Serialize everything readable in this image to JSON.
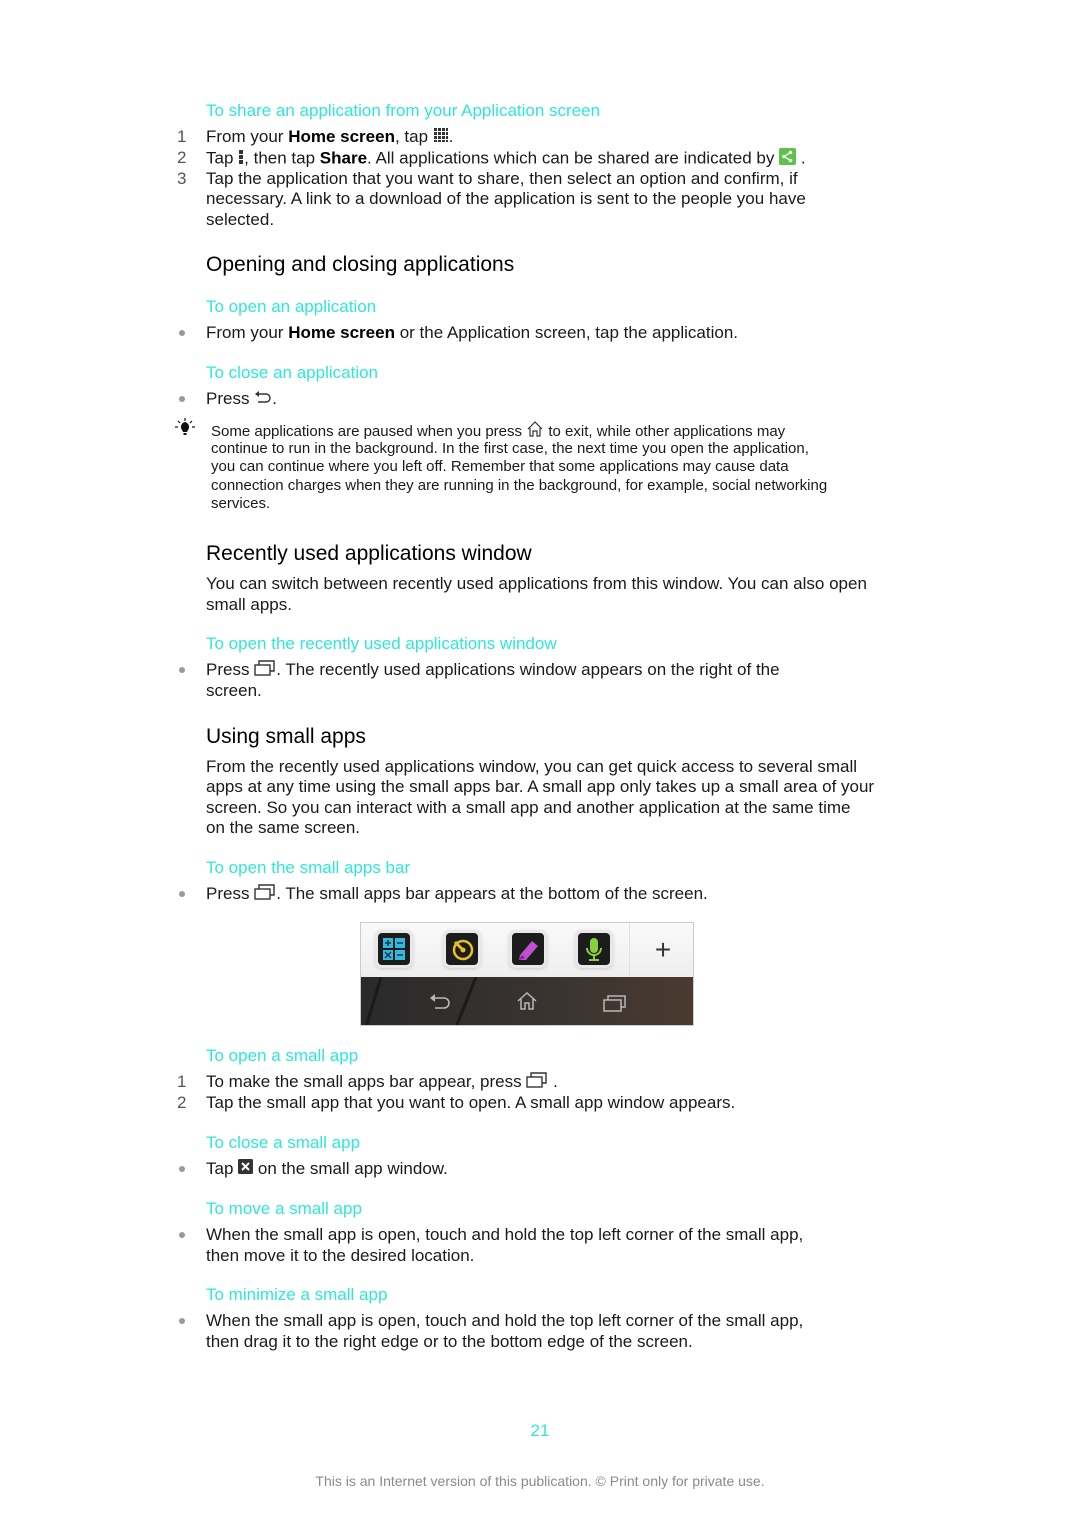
{
  "share_section": {
    "subheading": "To share an application from your Application screen",
    "steps": [
      {
        "num": "1",
        "pre": "From your ",
        "bold": "Home screen",
        "post": ", tap",
        "end": "."
      },
      {
        "num": "2",
        "pre": "Tap",
        "mid": ", then tap ",
        "bold": "Share",
        "post": ". All applications which can be shared are indicated by",
        "end": "."
      },
      {
        "num": "3",
        "lines": [
          "Tap the application that you want to share, then select an option and confirm, if",
          "necessary. A link to a download of the application is sent to the people you have",
          "selected."
        ]
      }
    ]
  },
  "opening_section": {
    "heading": "Opening and closing applications",
    "open_sub": "To open an application",
    "open_bullet": {
      "pre": "From your ",
      "bold": "Home screen",
      "post": " or the Application screen, tap the application."
    },
    "close_sub": "To close an application",
    "close_bullet": {
      "pre": "Press",
      "post": "."
    },
    "tip": {
      "icon": "lightbulb-tip-icon",
      "line1_pre": "Some applications are paused when you press",
      "line1_post": "to exit, while other applications may",
      "lines": [
        "continue to run in the background. In the first case, the next time you open the application,",
        "you can continue where you left off. Remember that some applications may cause data",
        "connection charges when they are running in the background, for example, social networking",
        "services."
      ]
    }
  },
  "recent_section": {
    "heading": "Recently used applications window",
    "intro": [
      "You can switch between recently used applications from this window. You can also open",
      "small apps."
    ],
    "sub": "To open the recently used applications window",
    "bullet_pre": "Press",
    "bullet_post": ". The recently used applications window appears on the right of the",
    "bullet_line2": "screen."
  },
  "small_apps_section": {
    "heading": "Using small apps",
    "intro": [
      "From the recently used applications window, you can get quick access to several small",
      "apps at any time using the small apps bar. A small app only takes up a small area of your",
      "screen. So you can interact with a small app and another application at the same time",
      "on the same screen."
    ],
    "bar_sub": "To open the small apps bar",
    "bar_bullet_pre": "Press",
    "bar_bullet_post": ". The small apps bar appears at the bottom of the screen.",
    "screenshot": {
      "apps": [
        "calculator-app-icon",
        "timer-app-icon",
        "notes-app-icon",
        "voice-recorder-app-icon"
      ],
      "add_label": "+",
      "nav": [
        "back-icon",
        "home-icon",
        "recent-apps-icon"
      ]
    },
    "open_sub": "To open a small app",
    "open_steps": [
      {
        "num": "1",
        "pre": "To make the small apps bar appear, press",
        "post": " ."
      },
      {
        "num": "2",
        "text": "Tap the small app that you want to open. A small app window appears."
      }
    ],
    "close_sub": "To close a small app",
    "close_bullet_pre": "Tap",
    "close_bullet_post": "on the small app window.",
    "move_sub": "To move a small app",
    "move_bullet": [
      "When the small app is open, touch and hold the top left corner of the small app,",
      "then move it to the desired location."
    ],
    "min_sub": "To minimize a small app",
    "min_bullet": [
      "When the small app is open, touch and hold the top left corner of the small app,",
      "then drag it to the right edge or to the bottom edge of the screen."
    ]
  },
  "footer": {
    "page_number": "21",
    "notice": "This is an Internet version of this publication. © Print only for private use."
  },
  "colors": {
    "accent": "#2ee8d6",
    "text": "#1a1a1a"
  }
}
